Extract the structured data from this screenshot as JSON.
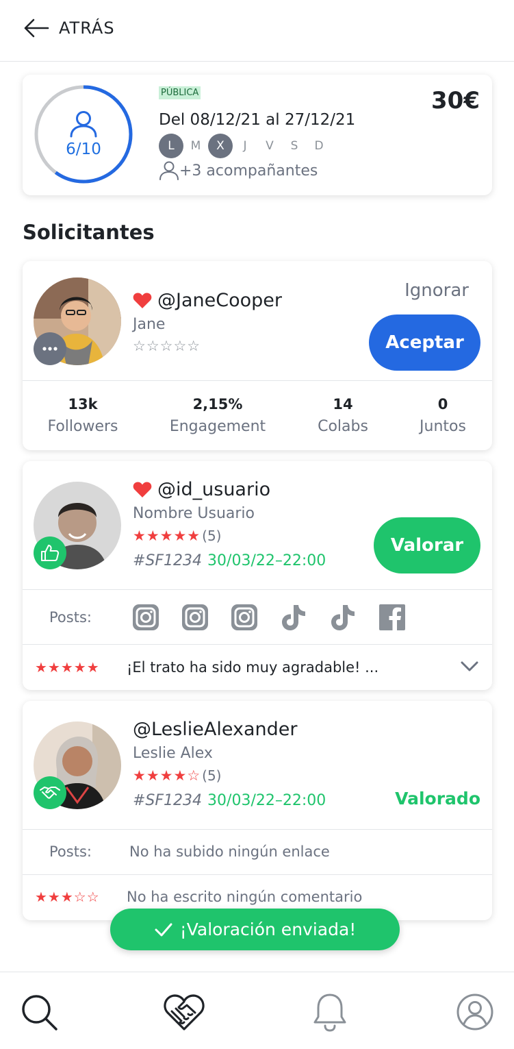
{
  "header": {
    "back_label": "ATRÁS"
  },
  "offer": {
    "slots": "6/10",
    "filled_fraction": 0.6,
    "visibility": "PÚBLICA",
    "dates": "Del 08/12/21 al 27/12/21",
    "days": [
      {
        "label": "L",
        "active": true
      },
      {
        "label": "M",
        "active": false
      },
      {
        "label": "X",
        "active": true
      },
      {
        "label": "J",
        "active": false
      },
      {
        "label": "V",
        "active": false
      },
      {
        "label": "S",
        "active": false
      },
      {
        "label": "D",
        "active": false
      }
    ],
    "companions": "+3 acompañantes",
    "price": "30€"
  },
  "section_title": "Solicitantes",
  "applicants": [
    {
      "handle": "@JaneCooper",
      "favorite": true,
      "name": "Jane",
      "rating": 0,
      "ignore_label": "Ignorar",
      "accept_label": "Aceptar",
      "badge_icon": "more-icon",
      "stats": [
        {
          "value": "13k",
          "label": "Followers"
        },
        {
          "value": "2,15%",
          "label": "Engagement"
        },
        {
          "value": "14",
          "label": "Colabs"
        },
        {
          "value": "0",
          "label": "Juntos"
        }
      ]
    },
    {
      "handle": "@id_usuario",
      "favorite": true,
      "name": "Nombre Usuario",
      "rating": 5,
      "rating_count": "(5)",
      "ref": "#SF1234",
      "datetime": "30/03/22–22:00",
      "rate_label": "Valorar",
      "badge_icon": "thumbs-up-icon",
      "posts_label": "Posts:",
      "posts": [
        "instagram-icon",
        "instagram-icon",
        "instagram-icon",
        "tiktok-icon",
        "tiktok-icon",
        "facebook-icon"
      ],
      "review_rating": 5,
      "review_text": "¡El trato ha sido muy agradable! ..."
    },
    {
      "handle": "@LeslieAlexander",
      "favorite": false,
      "name": "Leslie Alex",
      "rating": 4,
      "rating_count": "(5)",
      "ref": "#SF1234",
      "datetime": "30/03/22–22:00",
      "status_label": "Valorado",
      "badge_icon": "handshake-icon",
      "posts_label": "Posts:",
      "no_links_text": "No ha subido ningún enlace",
      "review_rating": 3,
      "review_text": "No ha escrito ningún comentario"
    }
  ],
  "toast": {
    "text": "¡Valoración enviada!"
  },
  "tabbar": [
    "search-icon",
    "handshake-heart-icon",
    "bell-icon",
    "profile-icon"
  ],
  "colors": {
    "primary": "#2469e1",
    "success": "#1fc46c",
    "star": "#f03e3e",
    "muted": "#6b7280"
  }
}
